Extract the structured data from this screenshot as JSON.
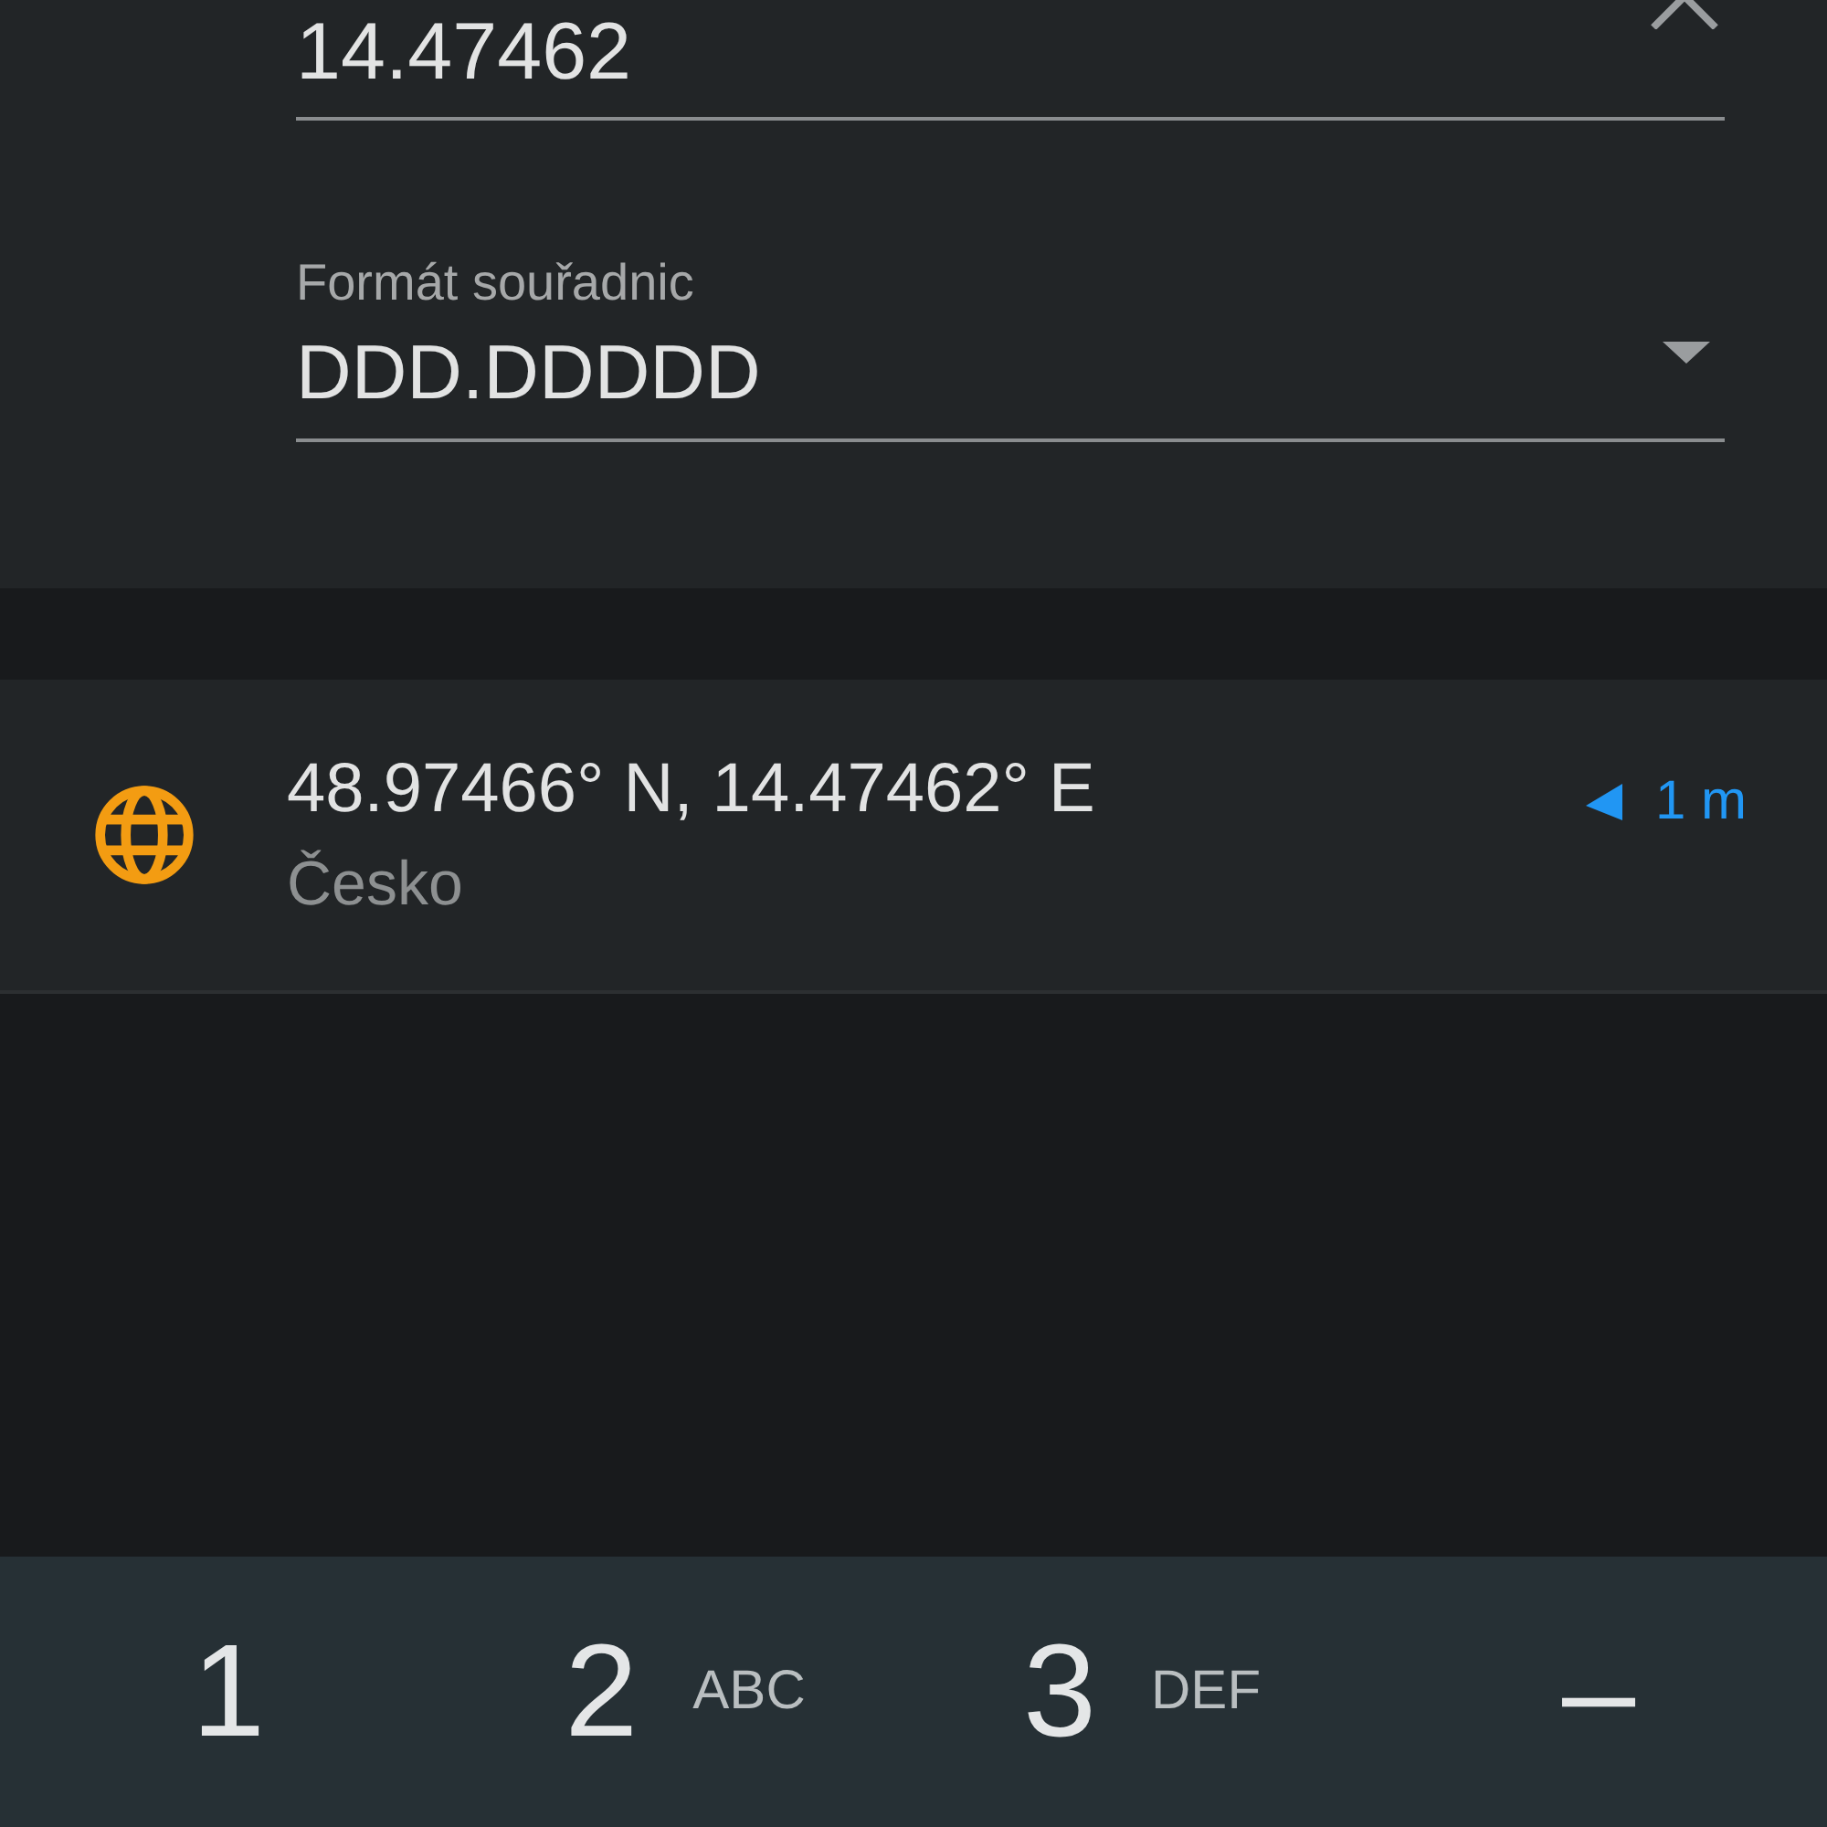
{
  "coordinate_field": {
    "value": "14.47462"
  },
  "format_field": {
    "label": "Formát souřadnic",
    "value": "DDD.DDDDD"
  },
  "result": {
    "title": "48.97466° N, 14.47462° E",
    "subtitle": "Česko",
    "distance": "1 m"
  },
  "keypad": {
    "keys": [
      {
        "digit": "1"
      },
      {
        "digit": "2",
        "letters": "ABC"
      },
      {
        "digit": "3",
        "letters": "DEF"
      },
      {
        "digit": "–"
      }
    ]
  }
}
